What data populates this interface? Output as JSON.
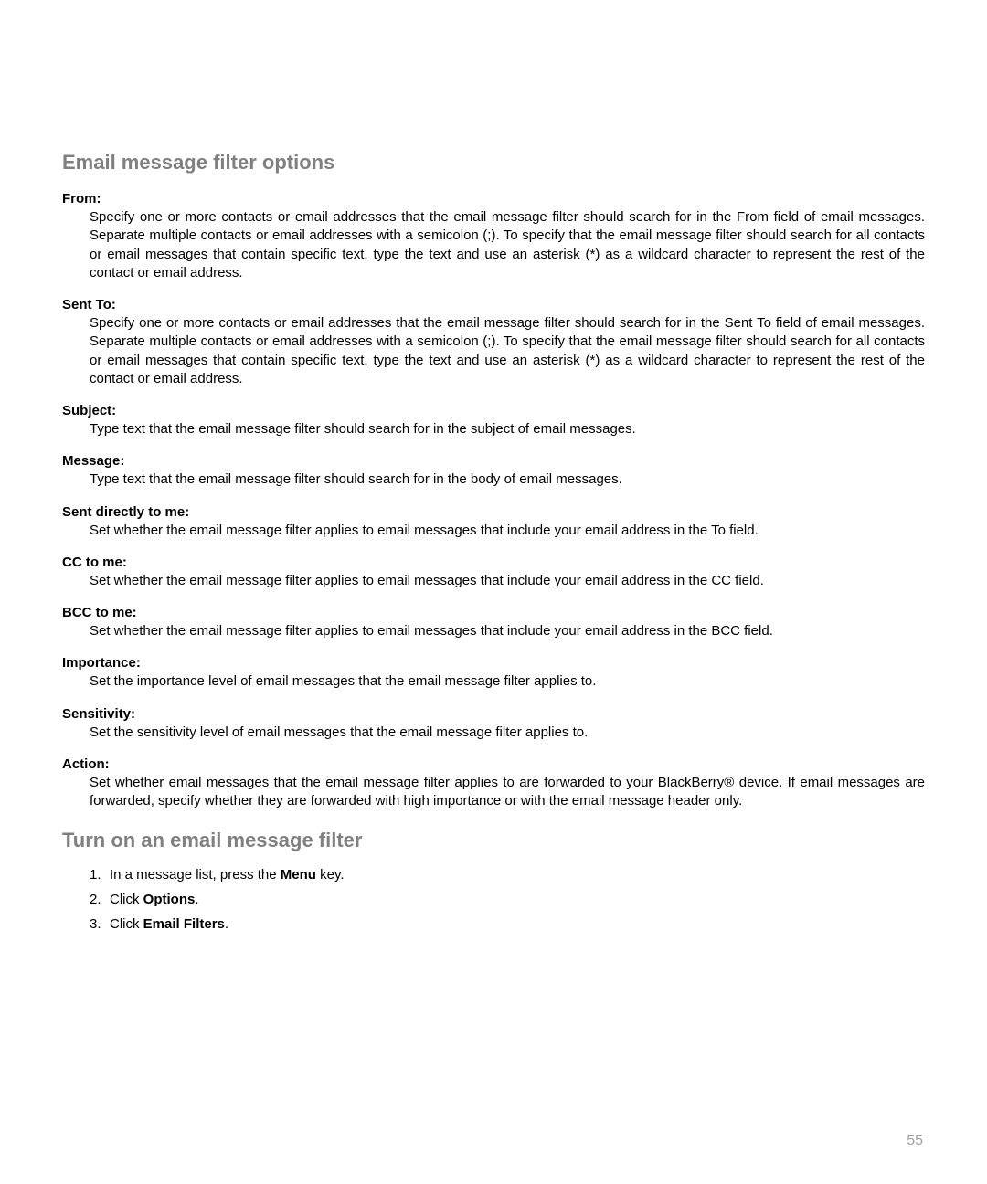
{
  "headings": {
    "options": "Email message filter options",
    "turnon": "Turn on an email message filter"
  },
  "options": {
    "from": {
      "term": "From:",
      "desc": "Specify one or more contacts or email addresses that the email message filter should search for in the From field of email messages. Separate multiple contacts or email addresses with a semicolon (;). To specify that the email message filter should search for all contacts or email messages that contain specific text, type the text and use an asterisk (*) as a wildcard character to represent the rest of the contact or email address."
    },
    "sentto": {
      "term": "Sent To:",
      "desc": "Specify one or more contacts or email addresses that the email message filter should search for in the Sent To field of email messages. Separate multiple contacts or email addresses with a semicolon (;). To specify that the email message filter should search for all contacts or email messages that contain specific text, type the text and use an asterisk (*) as a wildcard character to represent the rest of the contact or email address."
    },
    "subject": {
      "term": "Subject:",
      "desc": "Type text that the email message filter should search for in the subject of email messages."
    },
    "message": {
      "term": "Message:",
      "desc": "Type text that the email message filter should search for in the body of email messages."
    },
    "sentdirect": {
      "term": "Sent directly to me:",
      "desc": "Set whether the email message filter applies to email messages that include your email address in the To field."
    },
    "cctome": {
      "term": "CC to me:",
      "desc": "Set whether the email message filter applies to email messages that include your email address in the CC field."
    },
    "bcctome": {
      "term": "BCC to me:",
      "desc": "Set whether the email message filter applies to email messages that include your email address in the BCC field."
    },
    "importance": {
      "term": "Importance:",
      "desc": "Set the importance level of email messages that the email message filter applies to."
    },
    "sensitivity": {
      "term": "Sensitivity:",
      "desc": "Set the sensitivity level of email messages that the email message filter applies to."
    },
    "action": {
      "term": "Action:",
      "desc": "Set whether email messages that the email message filter applies to are forwarded to your BlackBerry® device. If email messages are forwarded, specify whether they are forwarded with high importance or with the email message header only."
    }
  },
  "steps": {
    "s1": {
      "num": "1.",
      "pre": "In a message list, press the ",
      "bold": "Menu",
      "post": " key."
    },
    "s2": {
      "num": "2.",
      "pre": "Click ",
      "bold": "Options",
      "post": "."
    },
    "s3": {
      "num": "3.",
      "pre": "Click ",
      "bold": "Email Filters",
      "post": "."
    }
  },
  "page_number": "55"
}
